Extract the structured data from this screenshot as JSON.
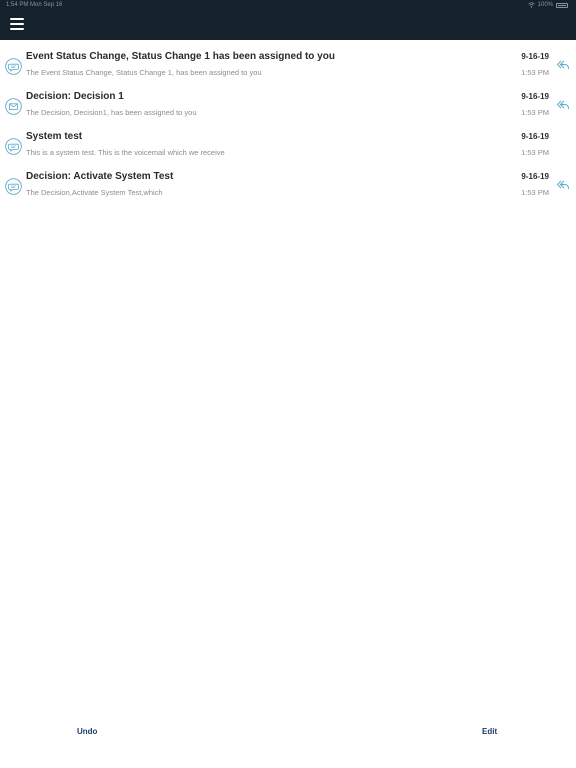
{
  "status_bar": {
    "time_date": "1:54 PM   Mon Sep 16",
    "battery": "100%"
  },
  "header": {
    "menu_icon": "hamburger-menu-icon"
  },
  "messages": [
    {
      "icon": "speech-bubble-icon",
      "title": "Event Status Change, Status Change 1 has been assigned to you",
      "preview": "The Event Status Change, Status Change 1, has been assigned to you",
      "date": "9-16-19",
      "time": "1:53 PM",
      "has_reply": true
    },
    {
      "icon": "envelope-icon",
      "title": "Decision: Decision 1",
      "preview": "The Decision, Decision1, has been assigned to you",
      "date": "9-16-19",
      "time": "1:53 PM",
      "has_reply": true
    },
    {
      "icon": "speech-bubble-icon",
      "title": "System test",
      "preview": "This is a system test. This is the voicemail which we receive",
      "date": "9-16-19",
      "time": "1:53 PM",
      "has_reply": false
    },
    {
      "icon": "speech-bubble-icon",
      "title": "Decision: Activate System Test",
      "preview": "The Decision,Activate System Test,which",
      "date": "9-16-19",
      "time": "1:53 PM",
      "has_reply": true
    }
  ],
  "toolbar": {
    "undo_label": "Undo",
    "edit_label": "Edit"
  },
  "colors": {
    "header_bg": "#16222b",
    "icon_accent": "#5aa9c9",
    "toolbar_text": "#1d3a6e"
  }
}
